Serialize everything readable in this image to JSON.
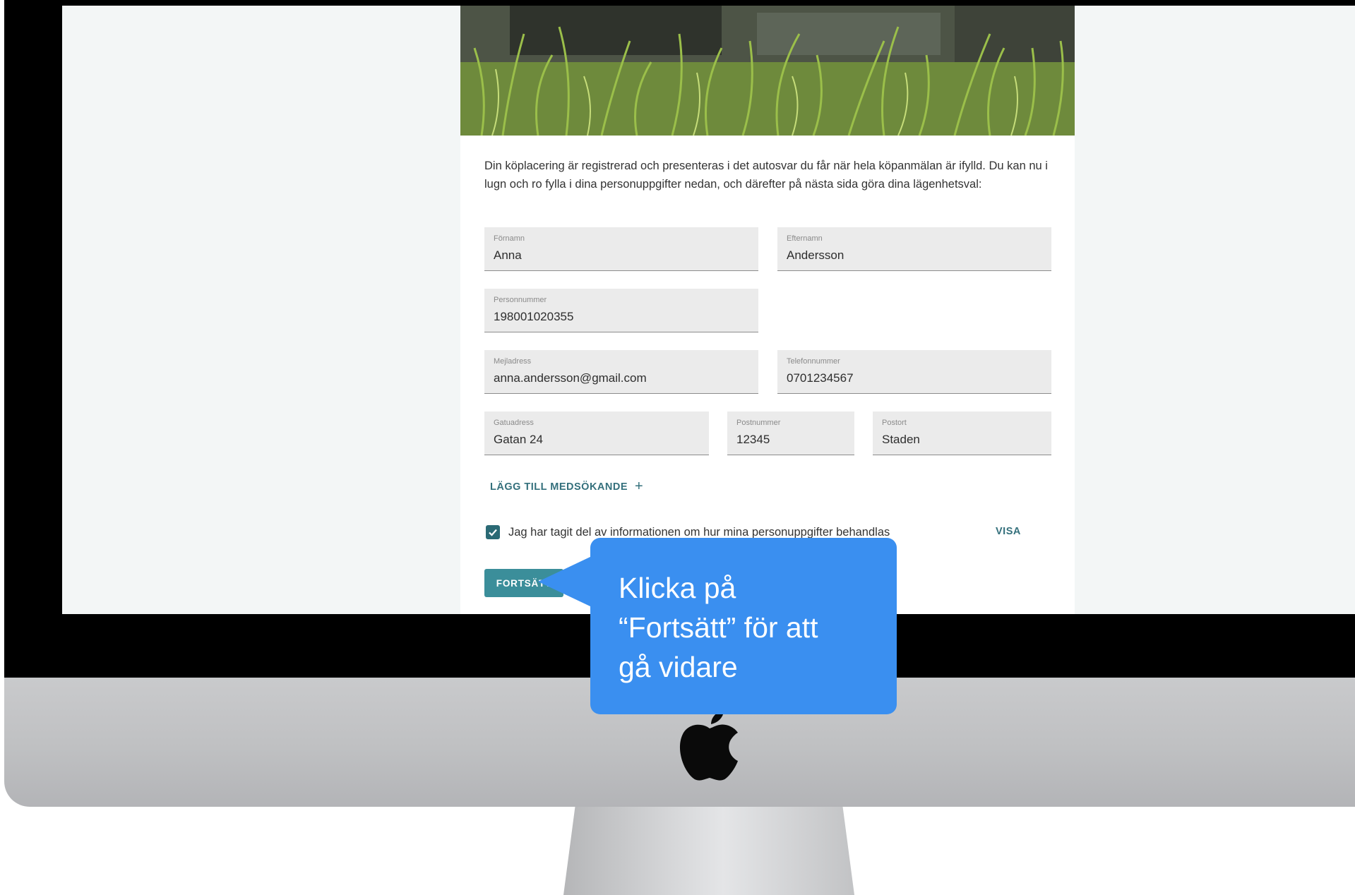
{
  "form": {
    "intro_text": "Din köplacering är registrerad och presenteras i det autosvar du får när hela köpanmälan är ifylld. Du kan nu i lugn och ro fylla i dina personuppgifter nedan, och därefter på nästa sida göra dina lägenhetsval:",
    "fields": {
      "first_name": {
        "label": "Förnamn",
        "value": "Anna"
      },
      "last_name": {
        "label": "Efternamn",
        "value": "Andersson"
      },
      "personal_number": {
        "label": "Personnummer",
        "value": "198001020355"
      },
      "email": {
        "label": "Mejladress",
        "value": "anna.andersson@gmail.com"
      },
      "phone": {
        "label": "Telefonnummer",
        "value": "0701234567"
      },
      "street": {
        "label": "Gatuadress",
        "value": "Gatan 24"
      },
      "postal_code": {
        "label": "Postnummer",
        "value": "12345"
      },
      "city": {
        "label": "Postort",
        "value": "Staden"
      }
    },
    "add_co_applicant_label": "LÄGG TILL MEDSÖKANDE",
    "consent_label": "Jag har tagit del av informationen om hur mina personuppgifter behandlas",
    "consent_checked": true,
    "show_link_label": "VISA",
    "continue_label": "FORTSÄTT"
  },
  "callout": {
    "text": "Klicka på\n“Fortsätt” för att\ngå vidare",
    "color": "#3a8ff0"
  },
  "colors": {
    "accent": "#34707c",
    "button": "#3b8e9a",
    "checkbox": "#2b6a75"
  },
  "icons": {
    "add": "plus-icon",
    "check": "check-icon",
    "logo": "apple-logo-icon"
  }
}
